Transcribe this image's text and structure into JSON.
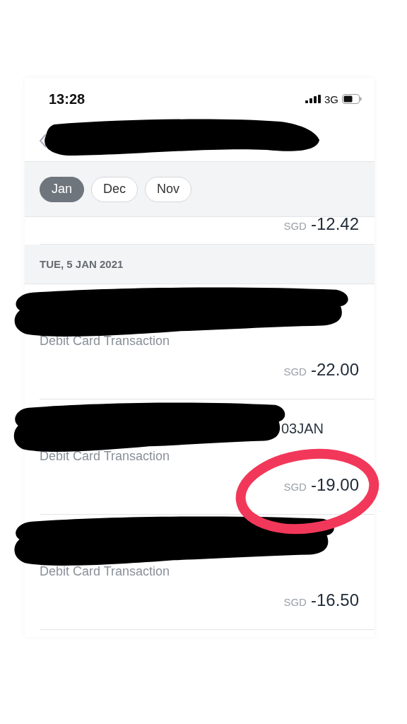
{
  "status_bar": {
    "time": "13:28",
    "network": "3G"
  },
  "nav": {
    "title_redacted": true
  },
  "month_filter": [
    {
      "label": "Jan",
      "selected": true
    },
    {
      "label": "Dec",
      "selected": false
    },
    {
      "label": "Nov",
      "selected": false
    }
  ],
  "previous_amount": {
    "currency": "SGD",
    "amount": "-12.42"
  },
  "sections": [
    {
      "date": "TUE, 5 JAN 2021",
      "transactions": [
        {
          "title_redacted": true,
          "description": "Debit Card Transaction",
          "currency": "SGD",
          "amount": "-22.00",
          "circled": false
        },
        {
          "title_redacted": true,
          "title_suffix": "03JAN",
          "description": "Debit Card Transaction",
          "currency": "SGD",
          "amount": "-19.00",
          "circled": true
        },
        {
          "title_redacted": true,
          "description": "Debit Card Transaction",
          "currency": "SGD",
          "amount": "-16.50",
          "circled": false
        }
      ]
    }
  ]
}
